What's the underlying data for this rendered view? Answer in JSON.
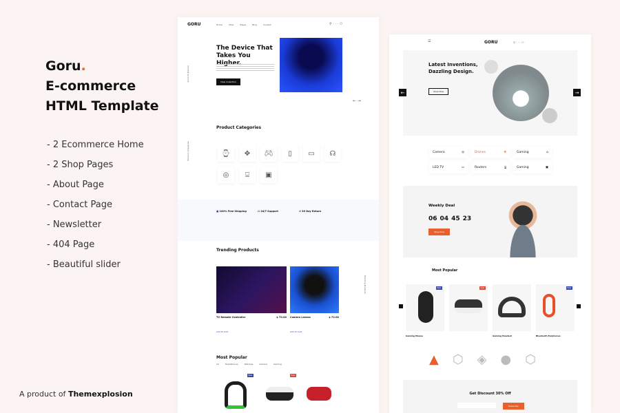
{
  "intro": {
    "brand": "Goru",
    "dot": ".",
    "line2": "E-commerce",
    "line3": "HTML Template",
    "features": [
      "- 2 Ecommerce Home",
      "- 2 Shop Pages",
      "- About Page",
      "- Contact Page",
      "- Newsletter",
      "- 404 Page",
      "- Beautiful slider"
    ],
    "credit_prefix": "A product of ",
    "credit_brand": "Themexplosion"
  },
  "colors": {
    "accent": "#e8612c",
    "background": "#fcf4f3",
    "badge_blue": "#3a4aa8",
    "badge_red": "#e0483a"
  },
  "home1": {
    "logo": "GORU",
    "nav": [
      "Home",
      "Shop",
      "Pages",
      "Blog",
      "Contact"
    ],
    "hero_title": "The Device That Takes You Higher.",
    "hero_button": "View Collection",
    "side_label": "Scroll To Explore",
    "categories_title": "Product Categories",
    "categories_side": "Product Categories",
    "services": [
      {
        "icon": "truck-icon",
        "title": "100% Free Shipping"
      },
      {
        "icon": "headset-icon",
        "title": "24/7 Support"
      },
      {
        "icon": "return-icon",
        "title": "30 Day Return"
      }
    ],
    "trending_title": "Trending Products",
    "trending_side": "Trending Products",
    "trending": [
      {
        "name": "TV Remote Controller",
        "price": "$ 70.00",
        "link": "Add To Cart"
      },
      {
        "name": "Camera Lenses",
        "price": "$ 72.00",
        "link": "Add To Cart"
      }
    ],
    "popular_title": "Most Popular",
    "popular_tabs": [
      "All",
      "Headphones",
      "Watches",
      "Camera",
      "Gaming"
    ],
    "popular_badges": [
      "New",
      "Sale"
    ]
  },
  "home2": {
    "logo": "GORU",
    "hero_title": "Latest Inventions, Dazzling Design.",
    "hero_button": "Shop Now",
    "categories": [
      {
        "label": "Camera",
        "icon": "camera-icon"
      },
      {
        "label": "Drones",
        "icon": "drone-icon"
      },
      {
        "label": "Gaming",
        "icon": "gamepad-icon"
      },
      {
        "label": "LED TV",
        "icon": "tv-icon"
      },
      {
        "label": "Routers",
        "icon": "router-icon"
      },
      {
        "label": "Gaming",
        "icon": "monitor-icon"
      }
    ],
    "deal_title": "Weekly Deal",
    "timer": [
      "06",
      "04",
      "45",
      "23"
    ],
    "deal_button": "Shop Now",
    "popular_title": "Most Popular",
    "products": [
      {
        "name": "Gaming Mouse",
        "badge": "New"
      },
      {
        "name": "VR Headset",
        "badge": "Sale"
      },
      {
        "name": "Gaming Headset",
        "badge": ""
      },
      {
        "name": "Bluetooth Earphones",
        "badge": "New"
      }
    ],
    "newsletter_title": "Get Discount 30% Off",
    "newsletter_button": "Subscribe"
  }
}
